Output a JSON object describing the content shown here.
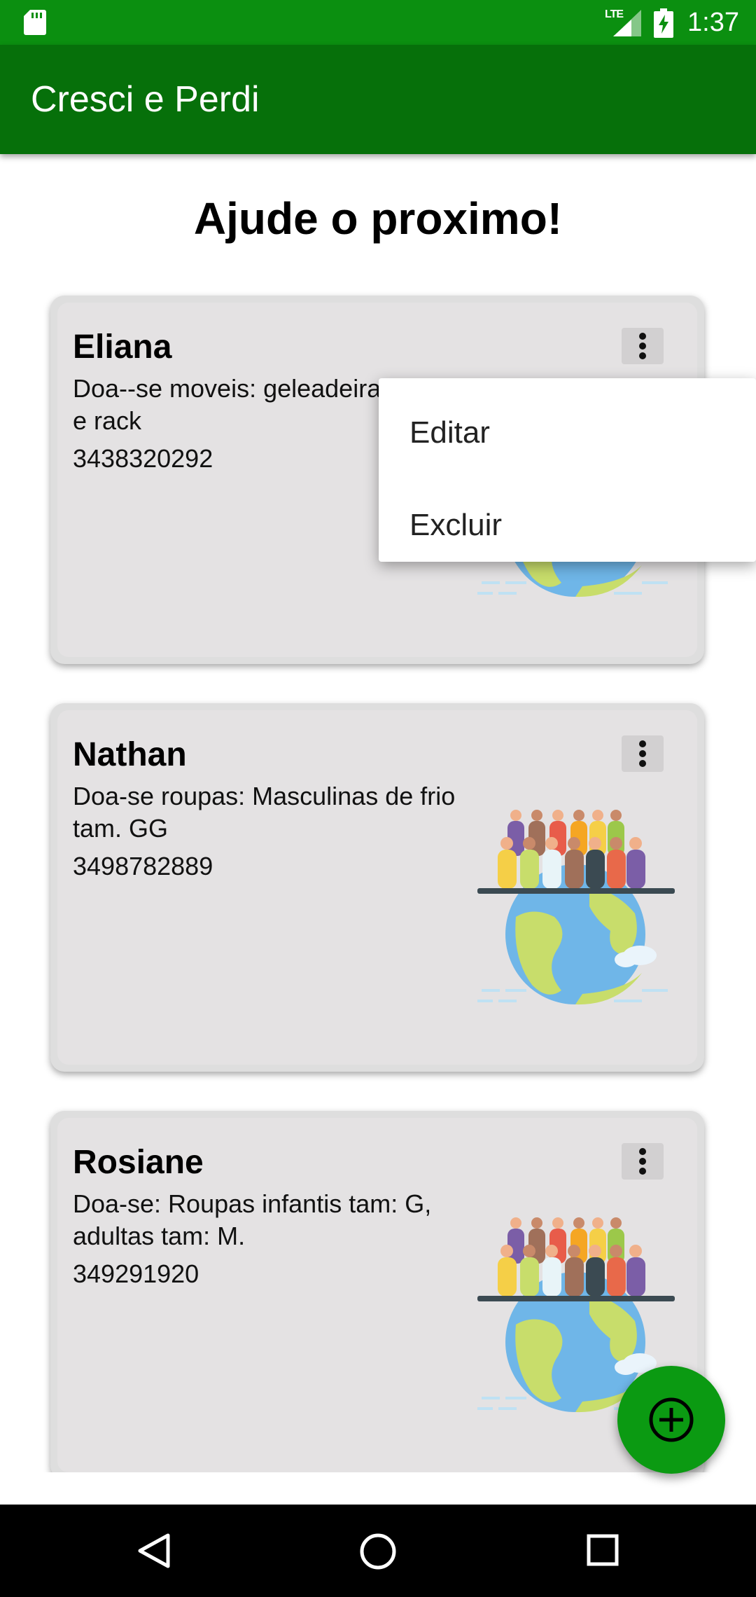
{
  "status_bar": {
    "network_type": "LTE",
    "time": "1:37"
  },
  "app_bar": {
    "title": "Cresci e Perdi"
  },
  "page": {
    "heading": "Ajude o proximo!"
  },
  "cards": [
    {
      "name": "Eliana",
      "description": "Doa--se moveis: geleadeira, cama e rack",
      "phone": "3438320292"
    },
    {
      "name": "Nathan",
      "description": "Doa-se roupas: Masculinas de frio tam. GG",
      "phone": "3498782889"
    },
    {
      "name": "Rosiane",
      "description": "Doa-se: Roupas infantis tam: G, adultas tam: M.",
      "phone": "349291920"
    }
  ],
  "popup_menu": {
    "items": [
      "Editar",
      "Excluir"
    ]
  },
  "icons": {
    "card_menu": "more-vert-icon",
    "fab": "add-circle-icon",
    "nav": [
      "back-icon",
      "home-icon",
      "recents-icon"
    ],
    "illustration": "people-on-globe-icon"
  },
  "colors": {
    "status_bar": "#0b8f10",
    "app_bar": "#06700a",
    "fab": "#0b9a12",
    "card": "#e4e2e3"
  }
}
